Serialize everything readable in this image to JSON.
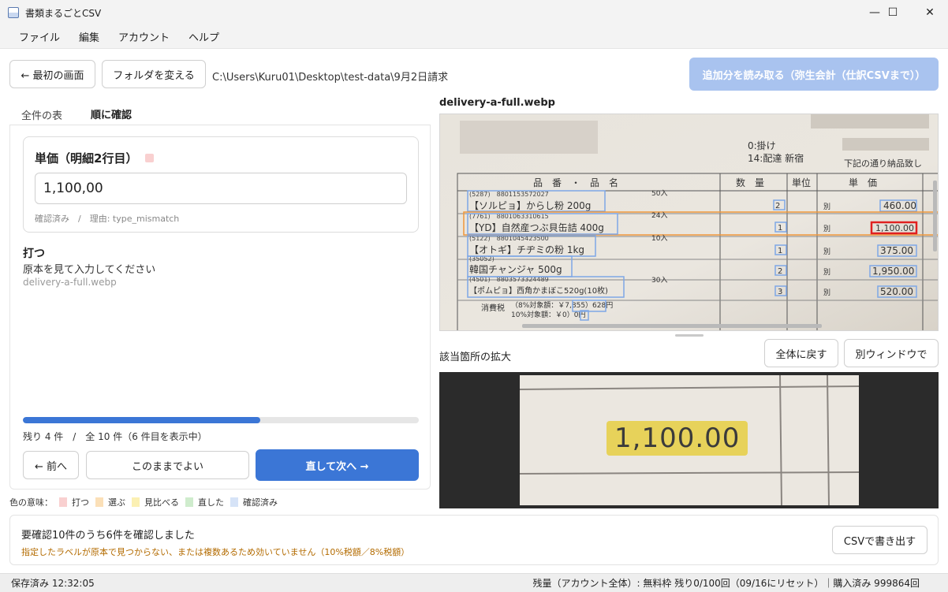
{
  "window": {
    "title": "書類まるごとCSV",
    "minimize": "—",
    "maximize": "☐",
    "close": "✕"
  },
  "menu": [
    "ファイル",
    "編集",
    "アカウント",
    "ヘルプ"
  ],
  "toolbar": {
    "back_label": "← 最初の画面",
    "change_folder_label": "フォルダを変える",
    "path": "C:\\Users\\Kuru01\\Desktop\\test-data\\9月2日請求",
    "read_more_label": "追加分を読み取る（弥生会計（仕訳CSVまで））"
  },
  "tabs": [
    "全件の表",
    "順に確認"
  ],
  "field": {
    "title": "単価（明細2行目）",
    "value": "1,100,00",
    "meta": "確認済み　/　理由: type_mismatch"
  },
  "reason": {
    "title": "打つ",
    "description": "原本を見て入力してください",
    "file": "delivery-a-full.webp"
  },
  "progress": {
    "fraction": 0.6,
    "text": "残り 4 件　/　全 10 件（6 件目を表示中）"
  },
  "nav": {
    "prev_label": "← 前へ",
    "keep_label": "このままでよい",
    "next_label": "直して次へ →"
  },
  "legend": {
    "label": "色の意味：",
    "items": [
      {
        "label": "打つ",
        "color": "#f9d0d0"
      },
      {
        "label": "選ぶ",
        "color": "#fbe0b8"
      },
      {
        "label": "見比べる",
        "color": "#fbf0b3"
      },
      {
        "label": "直した",
        "color": "#cfeccd"
      },
      {
        "label": "確認済み",
        "color": "#d6e3f7"
      }
    ]
  },
  "document": {
    "file_name": "delivery-a-full.webp",
    "zoom_label": "該当箇所の拡大",
    "reset_label": "全体に戻す",
    "separate_window_label": "別ウィンドウで",
    "zoom_value": "1,100.00",
    "invoice": {
      "header_a": "0:掛け",
      "header_b": "14:配達 新宿",
      "header_c": "下記の通り納品致し",
      "col_item": "品　番　・　品　名",
      "col_qty": "数　量",
      "col_unit": "単位",
      "col_price": "単　価",
      "rows": [
        {
          "code": "(5287)　8801153572027",
          "name": "【ソルピョ】からし粉 200g",
          "pack": "50入",
          "qty": "2",
          "price": "460.00"
        },
        {
          "code": "(7761)　8801063310615",
          "name": "【YD】自然産つぶ貝缶詰 400g",
          "pack": "24入",
          "qty": "1",
          "price": "1,100.00"
        },
        {
          "code": "(5122)　8801045423500",
          "name": "【オトギ】チヂミの粉 1kg",
          "pack": "10入",
          "qty": "1",
          "price": "375.00"
        },
        {
          "code": "(35052)",
          "name": "韓国チャンジャ 500g",
          "pack": "",
          "qty": "2",
          "price": "1,950.00"
        },
        {
          "code": "(4501)　8803573324489",
          "name": "【ポムピョ】西角かまぼこ520g(10枚)",
          "pack": "30入",
          "qty": "3",
          "price": "520.00"
        }
      ],
      "price_prefix": "別",
      "tax_label": "消費税",
      "tax_line_1": "（8%対象額：￥7,855）628円",
      "tax_line_2": "10%対象額：￥0）0円"
    }
  },
  "summary": {
    "title": "要確認10件のうち6件を確認しました",
    "warning": "指定したラベルが原本で見つからない、または複数あるため効いていません（10%税額／8%税額）",
    "export_label": "CSVで書き出す"
  },
  "status": {
    "saved": "保存済み 12:32:05",
    "quota": "残量（アカウント全体）: 無料枠 残り0/100回（09/16にリセット）｜購入済み 999864回"
  }
}
